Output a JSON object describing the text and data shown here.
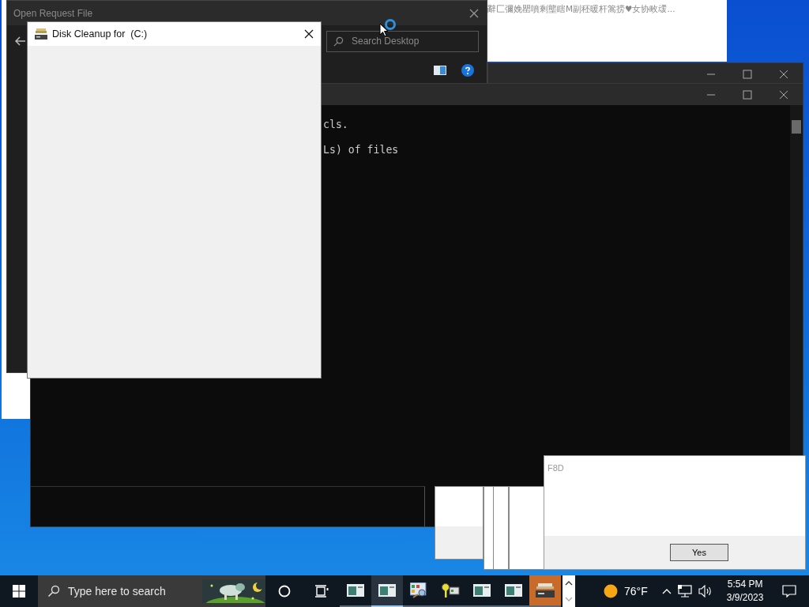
{
  "explorer_window": {
    "title": "Open Request File",
    "search": {
      "placeholder": "Search Desktop"
    }
  },
  "notification": {
    "text": "辭匚彌娩罌噴剩壟瞎M副秠暖杆篙捞♥女协畋叆..."
  },
  "console": {
    "lines": [
      "cls.",
      "Ls) of files"
    ]
  },
  "disk_cleanup": {
    "title": "Disk Cleanup for  (C:)"
  },
  "dialog": {
    "title": "F8D",
    "buttons": [
      "Yes"
    ]
  },
  "taskbar": {
    "search": {
      "placeholder": "Type here to search"
    },
    "apps": [
      {
        "kind": "window",
        "selected": false
      },
      {
        "kind": "window",
        "selected": true
      },
      {
        "kind": "panel",
        "selected": false
      },
      {
        "kind": "keys",
        "selected": false
      },
      {
        "kind": "window",
        "selected": false
      },
      {
        "kind": "window",
        "selected": false
      },
      {
        "kind": "drive",
        "selected": false
      }
    ],
    "weather": {
      "temperature": "76°F"
    },
    "clock": {
      "time": "5:54 PM",
      "date": "3/9/2023"
    }
  }
}
